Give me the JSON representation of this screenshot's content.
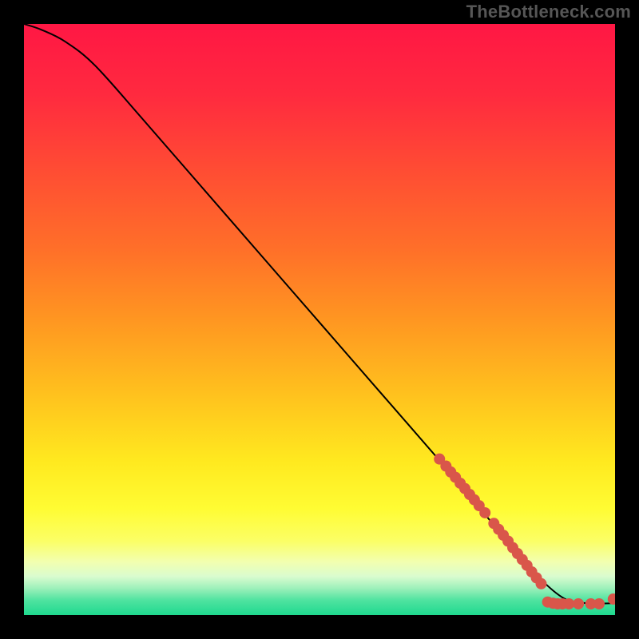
{
  "attribution": "TheBottleneck.com",
  "chart_data": {
    "type": "line",
    "title": "",
    "xlabel": "",
    "ylabel": "",
    "xlim": [
      0,
      100
    ],
    "ylim": [
      0,
      100
    ],
    "series": [
      {
        "name": "curve",
        "x": [
          0,
          3,
          7,
          12,
          20,
          30,
          40,
          50,
          60,
          70,
          78,
          84,
          88,
          92,
          96,
          100
        ],
        "y": [
          100,
          99,
          97,
          93,
          84,
          72.5,
          61,
          49.5,
          38,
          26.5,
          17,
          10,
          5.5,
          2.5,
          2,
          2
        ]
      }
    ],
    "markers": {
      "name": "data-points",
      "color": "#d9564a",
      "points": [
        {
          "x": 70.3,
          "y": 26.4
        },
        {
          "x": 71.4,
          "y": 25.2
        },
        {
          "x": 72.2,
          "y": 24.2
        },
        {
          "x": 73.0,
          "y": 23.3
        },
        {
          "x": 73.8,
          "y": 22.3
        },
        {
          "x": 74.6,
          "y": 21.4
        },
        {
          "x": 75.4,
          "y": 20.4
        },
        {
          "x": 76.2,
          "y": 19.5
        },
        {
          "x": 77.0,
          "y": 18.5
        },
        {
          "x": 78.0,
          "y": 17.3
        },
        {
          "x": 79.5,
          "y": 15.5
        },
        {
          "x": 80.3,
          "y": 14.5
        },
        {
          "x": 81.1,
          "y": 13.5
        },
        {
          "x": 81.9,
          "y": 12.5
        },
        {
          "x": 82.7,
          "y": 11.4
        },
        {
          "x": 83.5,
          "y": 10.4
        },
        {
          "x": 84.3,
          "y": 9.4
        },
        {
          "x": 85.1,
          "y": 8.4
        },
        {
          "x": 85.9,
          "y": 7.3
        },
        {
          "x": 86.7,
          "y": 6.3
        },
        {
          "x": 87.5,
          "y": 5.3
        },
        {
          "x": 88.6,
          "y": 2.2
        },
        {
          "x": 89.5,
          "y": 2.0
        },
        {
          "x": 90.3,
          "y": 1.9
        },
        {
          "x": 91.1,
          "y": 1.9
        },
        {
          "x": 92.2,
          "y": 1.9
        },
        {
          "x": 93.8,
          "y": 1.9
        },
        {
          "x": 95.9,
          "y": 1.9
        },
        {
          "x": 97.3,
          "y": 1.9
        },
        {
          "x": 99.7,
          "y": 2.7
        }
      ]
    },
    "background_gradient": {
      "stops": [
        {
          "pos": 0.0,
          "color": "#ff1744"
        },
        {
          "pos": 0.12,
          "color": "#ff2a3f"
        },
        {
          "pos": 0.25,
          "color": "#ff4d33"
        },
        {
          "pos": 0.38,
          "color": "#ff6f29"
        },
        {
          "pos": 0.5,
          "color": "#ff9621"
        },
        {
          "pos": 0.62,
          "color": "#ffbf1e"
        },
        {
          "pos": 0.74,
          "color": "#ffe91f"
        },
        {
          "pos": 0.82,
          "color": "#fffc33"
        },
        {
          "pos": 0.875,
          "color": "#fbff66"
        },
        {
          "pos": 0.91,
          "color": "#f2ffb0"
        },
        {
          "pos": 0.935,
          "color": "#d9fccf"
        },
        {
          "pos": 0.955,
          "color": "#9cf0ba"
        },
        {
          "pos": 0.975,
          "color": "#4fe3a0"
        },
        {
          "pos": 1.0,
          "color": "#1fd98f"
        }
      ]
    }
  }
}
